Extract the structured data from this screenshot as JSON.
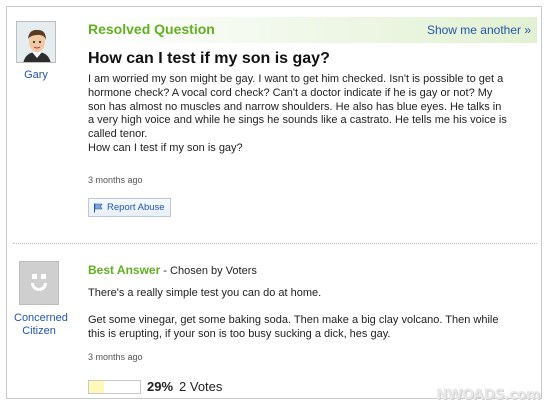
{
  "question": {
    "status_label": "Resolved Question",
    "show_another_label": "Show me another »",
    "asker_name": "Gary",
    "title": "How can I test if my son is gay?",
    "body_lines": [
      "I am worried my son might be gay. I want to get him checked. Isn't is possible to get a",
      "hormone check? A vocal cord check? Can't a doctor indicate if he is gay or not? My",
      "son has almost no muscles and narrow shoulders. He also has blue eyes. He talks in",
      "a very high voice and while he sings he sounds like a castrato. He tells me his voice is",
      "called tenor.",
      "How can I test if my son is gay?"
    ],
    "time_ago": "3 months ago",
    "report_label": "Report Abuse"
  },
  "answer": {
    "best_answer_label": "Best Answer",
    "chosen_by": " - Chosen by Voters",
    "answerer_line1": "Concerned",
    "answerer_line2": "Citizen",
    "paragraph1": "There's a really simple test you can do at home.",
    "paragraph2_lines": [
      "Get some vinegar, get some baking soda. Then make a big clay volcano. Then while",
      "this is erupting, if your son is too busy sucking a dick, hes gay."
    ],
    "time_ago": "3 months ago",
    "vote_fraction": 0.29,
    "vote_percent": "29%",
    "vote_count": "2 Votes"
  },
  "watermark": "NWOADS.com",
  "colors": {
    "accent_green": "#62b022",
    "link_blue": "#2255aa"
  },
  "icons": {
    "report": "flag-icon",
    "asker_avatar": "avatar",
    "answerer_avatar": "default-avatar"
  }
}
